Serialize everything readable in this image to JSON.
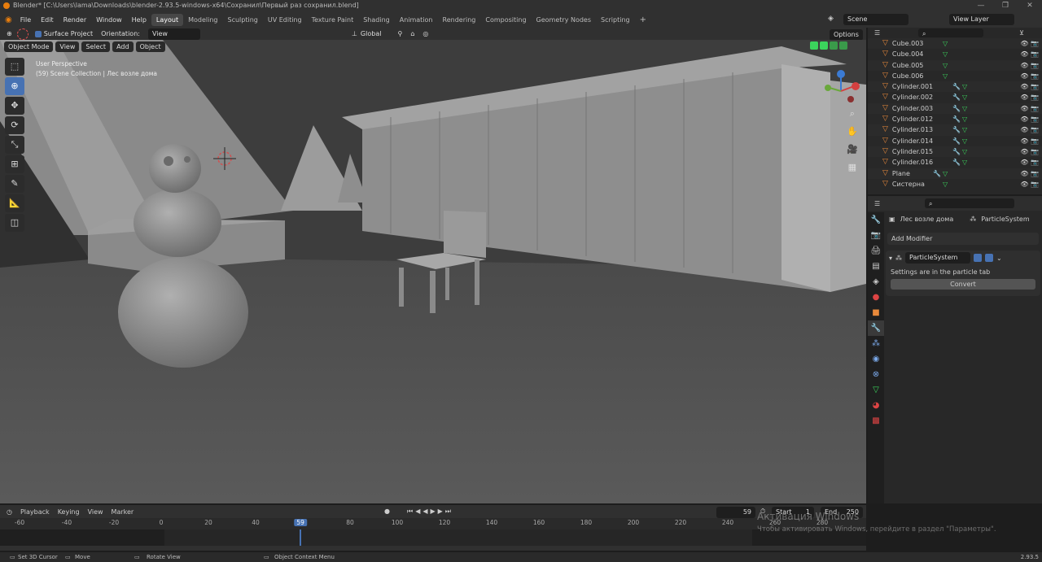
{
  "titlebar": {
    "text": "Blender* [C:\\Users\\lama\\Downloads\\blender-2.93.5-windows-x64\\Сохранил\\Первый раз сохранил.blend]"
  },
  "menu": [
    "File",
    "Edit",
    "Render",
    "Window",
    "Help"
  ],
  "workspaces": [
    "Layout",
    "Modeling",
    "Sculpting",
    "UV Editing",
    "Texture Paint",
    "Shading",
    "Animation",
    "Rendering",
    "Compositing",
    "Geometry Nodes",
    "Scripting"
  ],
  "active_workspace": "Layout",
  "scene": {
    "label": "Scene"
  },
  "view_layer": {
    "label": "View Layer"
  },
  "toolheader": {
    "surface_project": "Surface Project",
    "orientation_label": "Orientation:",
    "orientation_value": "View",
    "transform": "Global",
    "options": "Options"
  },
  "viewport": {
    "mode": "Object Mode",
    "menus": [
      "View",
      "Select",
      "Add",
      "Object"
    ],
    "perspective": "User Perspective",
    "collection": "(59) Scene Collection | Лес возле дома"
  },
  "outliner": {
    "items": [
      "Cube.003",
      "Cube.004",
      "Cube.005",
      "Cube.006",
      "Cylinder.001",
      "Cylinder.002",
      "Cylinder.003",
      "Cylinder.012",
      "Cylinder.013",
      "Cylinder.014",
      "Cylinder.015",
      "Cylinder.016",
      "Plane",
      "Систерна"
    ]
  },
  "properties": {
    "object_name": "Лес возле дома",
    "modifier_context": "ParticleSystem",
    "add_modifier": "Add Modifier",
    "modifier_name": "ParticleSystem",
    "settings_note": "Settings are in the particle tab",
    "convert": "Convert"
  },
  "timeline": {
    "menus": [
      "Playback",
      "Keying",
      "View",
      "Marker"
    ],
    "current_frame": "59",
    "start_label": "Start",
    "start": "1",
    "end_label": "End",
    "end": "250",
    "ticks": [
      "-60",
      "-40",
      "-20",
      "0",
      "20",
      "40",
      "59",
      "80",
      "100",
      "120",
      "140",
      "160",
      "180",
      "200",
      "220",
      "240",
      "260",
      "280"
    ],
    "tick_values": [
      -60,
      -40,
      -20,
      0,
      20,
      40,
      59,
      80,
      100,
      120,
      140,
      160,
      180,
      200,
      220,
      240,
      260,
      280
    ]
  },
  "statusbar": {
    "items": [
      "Set 3D Cursor",
      "Move",
      "Rotate View",
      "Object Context Menu"
    ],
    "version": "2.93.5"
  },
  "watermark": {
    "title": "Активация Windows",
    "subtitle": "Чтобы активировать Windows, перейдите в раздел \"Параметры\"."
  }
}
